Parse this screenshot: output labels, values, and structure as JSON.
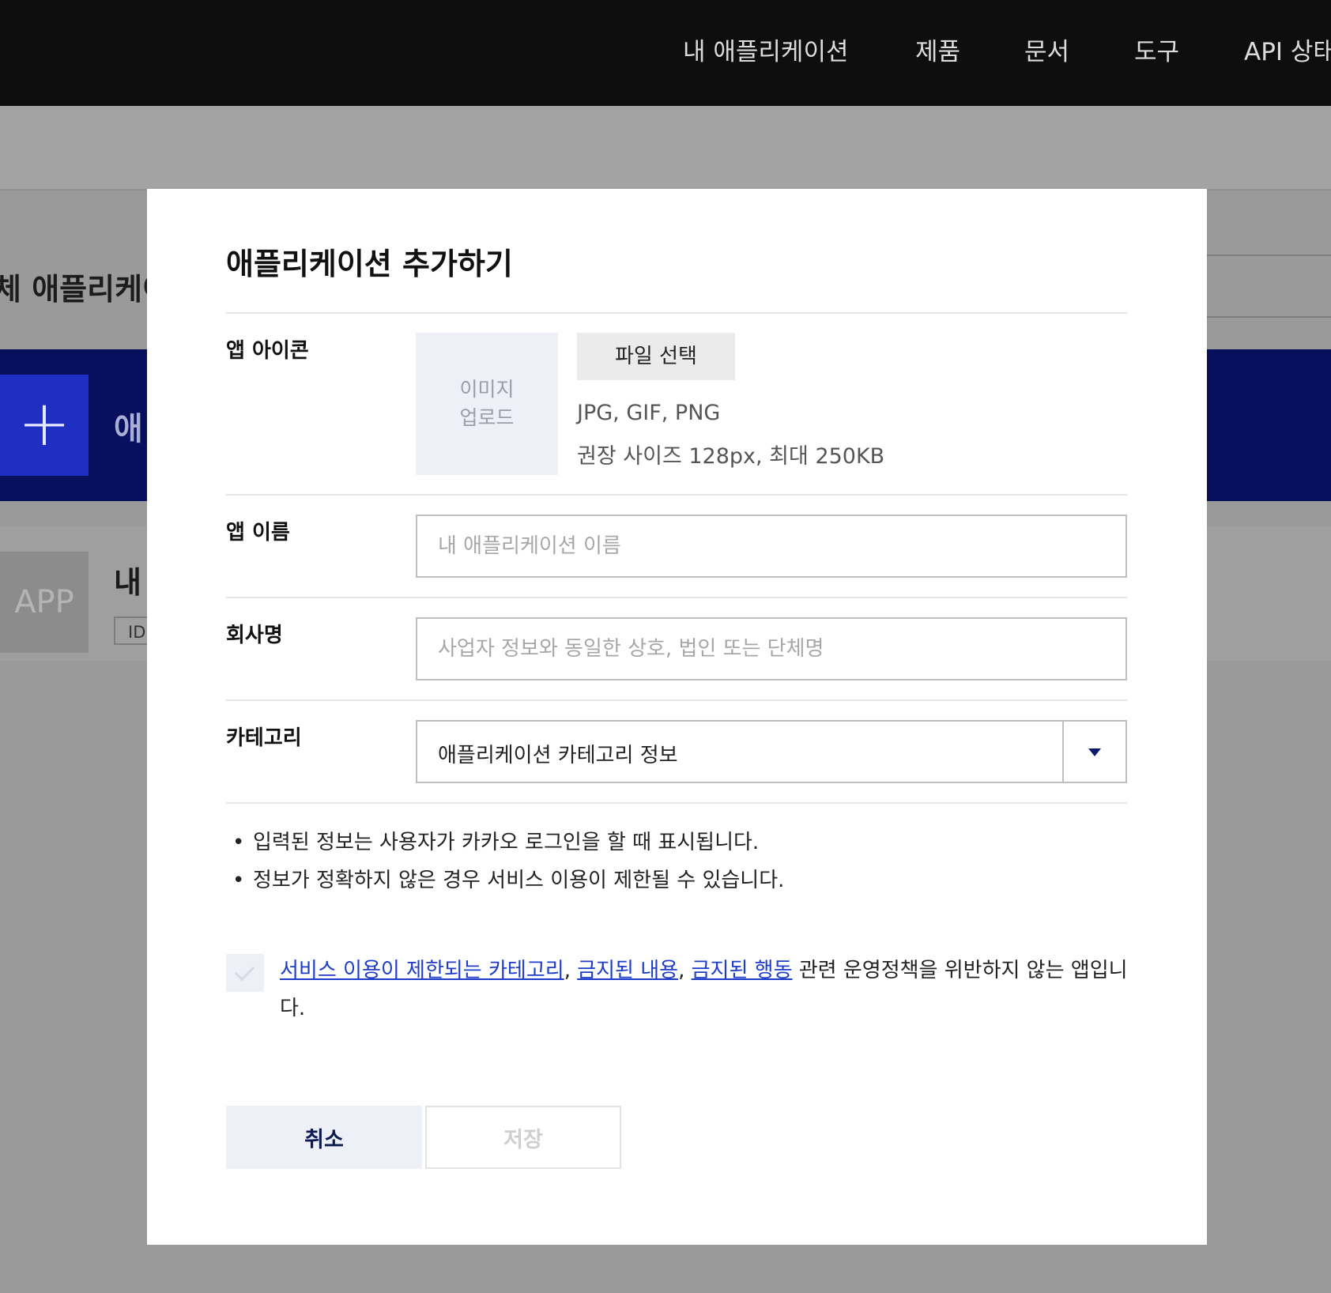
{
  "nav": {
    "items": [
      "내 애플리케이션",
      "제품",
      "문서",
      "도구",
      "API 상태"
    ]
  },
  "background": {
    "heading": "체 애플리케이",
    "banner_plus": "+",
    "banner_text": "애",
    "app_tile": "APP",
    "app_name": "내",
    "id_chip": "ID"
  },
  "modal": {
    "title": "애플리케이션 추가하기",
    "icon": {
      "label": "앱 아이콘",
      "upload_line1": "이미지",
      "upload_line2": "업로드",
      "file_button": "파일 선택",
      "formats": "JPG, GIF, PNG",
      "size_hint": "권장 사이즈 128px, 최대 250KB"
    },
    "app_name": {
      "label": "앱 이름",
      "value": "",
      "placeholder": "내 애플리케이션 이름"
    },
    "company": {
      "label": "회사명",
      "value": "",
      "placeholder": "사업자 정보와 동일한 상호, 법인 또는 단체명"
    },
    "category": {
      "label": "카테고리",
      "selected": "애플리케이션 카테고리 정보"
    },
    "notes": [
      "입력된 정보는 사용자가 카카오 로그인을 할 때 표시됩니다.",
      "정보가 정확하지 않은 경우 서비스 이용이 제한될 수 있습니다."
    ],
    "bullet": "•",
    "agreement": {
      "checked": false,
      "link1": "서비스 이용이 제한되는 카테고리",
      "sep1": ", ",
      "link2": "금지된 내용",
      "sep2": ", ",
      "link3": "금지된 행동",
      "suffix": " 관련 운영정책을 위반하지 않는 앱입니다."
    },
    "buttons": {
      "cancel": "취소",
      "save": "저장"
    }
  },
  "colors": {
    "nav_bg": "#0e0e0e",
    "banner_bg": "#06105c",
    "accent_blue": "#1f2fc4",
    "link": "#1e3cc8",
    "overlay": "#9a9a9a"
  }
}
